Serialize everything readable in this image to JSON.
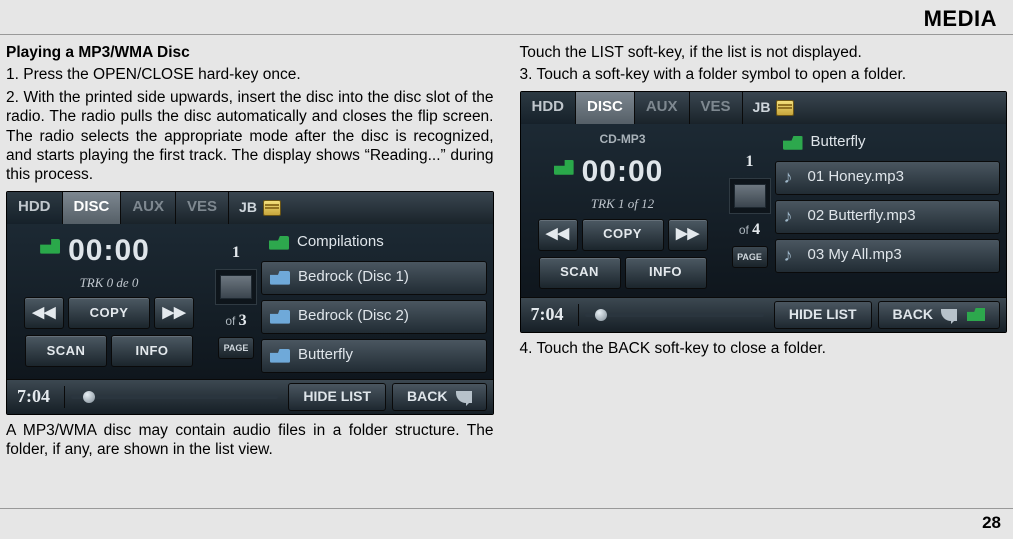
{
  "header": "MEDIA",
  "page_number": "28",
  "left": {
    "title": "Playing a MP3/WMA Disc",
    "step1": "1. Press the OPEN/CLOSE hard-key once.",
    "step2": "2. With the printed side upwards, insert the disc into the disc slot of the radio. The radio pulls the disc automatically and closes the flip screen. The radio selects the appropriate mode after the disc is recognized, and starts playing the first track. The display shows “Reading...” during this process.",
    "note": "A MP3/WMA disc  may contain audio files in a folder structure. The folder, if any, are shown in the list view."
  },
  "right": {
    "line1": "Touch the LIST soft-key, if the list is not displayed.",
    "step3": "3. Touch a soft-key with a folder symbol to open a folder.",
    "step4": "4. Touch the BACK soft-key to close a folder."
  },
  "panel1": {
    "tabs": {
      "hdd": "HDD",
      "disc": "DISC",
      "aux": "AUX",
      "ves": "VES",
      "jb": "JB"
    },
    "time": "00:00",
    "trk": "TRK 0 de 0",
    "buttons": {
      "copy": "COPY",
      "scan": "SCAN",
      "info": "INFO"
    },
    "page_of": "of",
    "page_total": "3",
    "page_current": "1",
    "page_label": "PAGE",
    "list_top": "Compilations",
    "list": [
      "Bedrock (Disc 1)",
      "Bedrock (Disc 2)",
      "Butterfly"
    ],
    "hide": "HIDE LIST",
    "back": "BACK",
    "clock": "7:04"
  },
  "panel2": {
    "tabs": {
      "hdd": "HDD",
      "disc": "DISC",
      "aux": "AUX",
      "ves": "VES",
      "jb": "JB"
    },
    "disclabel": "CD-MP3",
    "time": "00:00",
    "trk": "TRK 1 of 12",
    "buttons": {
      "copy": "COPY",
      "scan": "SCAN",
      "info": "INFO"
    },
    "page_of": "of",
    "page_total": "4",
    "page_current": "1",
    "page_label": "PAGE",
    "list_top": "Butterfly",
    "list": [
      "01 Honey.mp3",
      "02 Butterfly.mp3",
      "03 My All.mp3"
    ],
    "hide": "HIDE LIST",
    "back": "BACK",
    "clock": "7:04"
  }
}
